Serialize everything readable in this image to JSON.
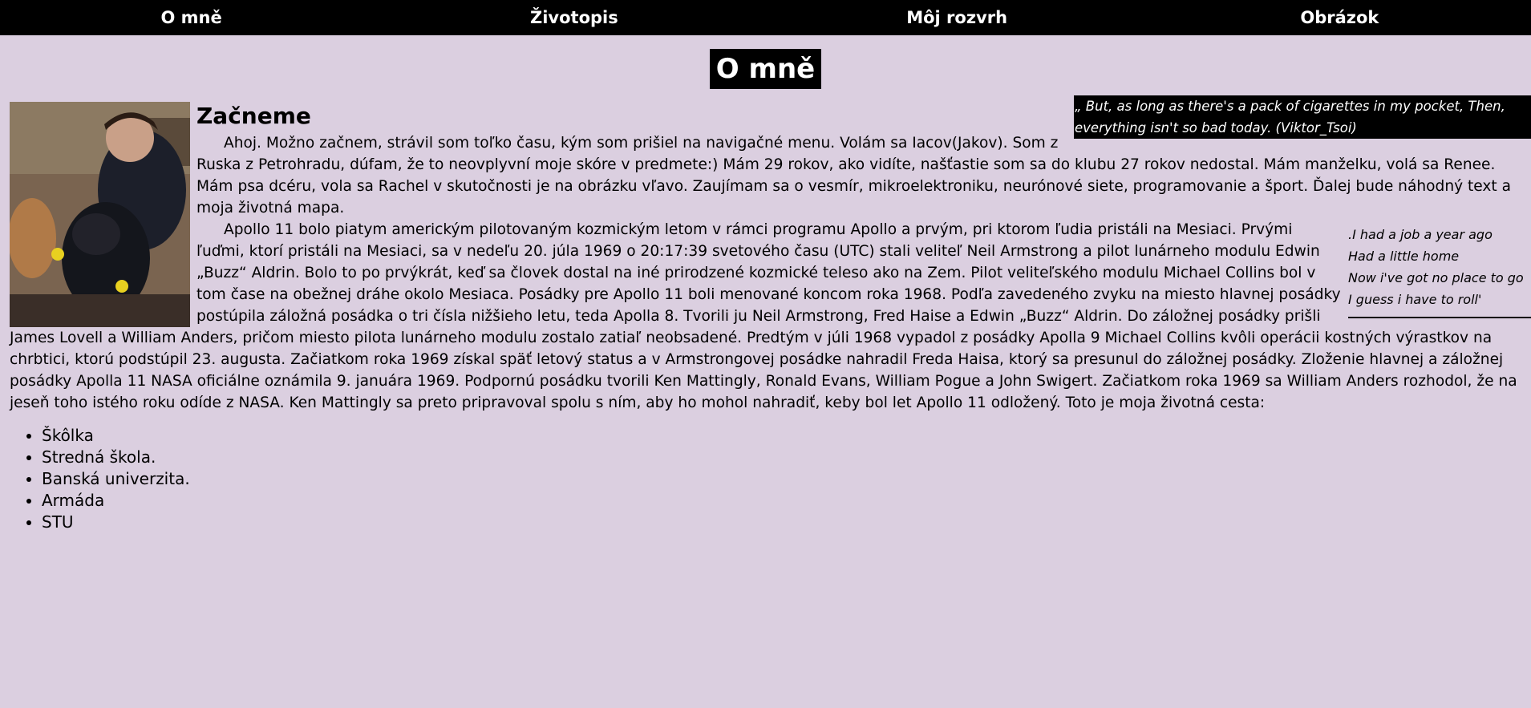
{
  "nav": {
    "items": [
      "O mně",
      "Životopis",
      "Môj rozvrh",
      "Obrázok"
    ]
  },
  "page_title": "O mně",
  "heading": "Začneme",
  "paragraph1": "Ahoj. Možno začnem, strávil som toľko času, kým som prišiel na navigačné menu. Volám sa Iacov(Jakov). Som z Ruska z Petrohradu, dúfam, že to neovplyvní moje skóre v predmete:) Mám 29 rokov, ako vidíte, našťastie som sa do klubu 27 rokov nedostal. Mám manželku, volá sa Renee. Mám psa dcéru, vola sa Rachel v skutočnosti je na obrázku vľavo. Zaujímam sa o vesmír, mikroelektroniku, neurónové siete, programovanie a šport. Ďalej bude náhodný text a moja životná mapa.",
  "paragraph2": "Apollo 11 bolo piatym americkým pilotovaným kozmickým letom v rámci programu Apollo a prvým, pri ktorom ľudia pristáli na Mesiaci. Prvými ľuďmi, ktorí pristáli na Mesiaci, sa v nedeľu 20. júla 1969 o 20:17:39 svetového času (UTC) stali veliteľ Neil Armstrong a pilot lunárneho modulu Edwin „Buzz“ Aldrin. Bolo to po prvýkrát, keď sa človek dostal na iné prirodzené kozmické teleso ako na Zem. Pilot veliteľského modulu Michael Collins bol v tom čase na obežnej dráhe okolo Mesiaca. Posádky pre Apollo 11 boli menované koncom roka 1968. Podľa zavedeného zvyku na miesto hlavnej posádky postúpila záložná posádka o tri čísla nižšieho letu, teda Apolla 8. Tvorili ju Neil Armstrong, Fred Haise a Edwin „Buzz“ Aldrin. Do záložnej posádky prišli James Lovell a William Anders, pričom miesto pilota lunárneho modulu zostalo zatiaľ neobsadené. Predtým v júli 1968 vypadol z posádky Apolla 9 Michael Collins kvôli operácii kostných výrastkov na chrbtici, ktorú podstúpil 23. augusta. Začiatkom roka 1969 získal späť letový status a v Armstrongovej posádke nahradil Freda Haisa, ktorý sa presunul do záložnej posádky. Zloženie hlavnej a záložnej posádky Apolla 11 NASA oficiálne oznámila 9. januára 1969. Podpornú posádku tvorili Ken Mattingly, Ronald Evans, William Pogue a John Swigert. Začiatkom roka 1969 sa William Anders rozhodol, že na jeseň toho istého roku odíde z NASA. Ken Mattingly sa preto pripravoval spolu s ním, aby ho mohol nahradiť, keby bol let Apollo 11 odložený. Toto je moja životná cesta:",
  "quote_top": "„ But, as long as there's a pack of cigarettes in my pocket, Then, everything isn't so bad today. (Viktor_Tsoi)",
  "quote_side": [
    ".I had a job a year ago",
    "Had a little home",
    "Now i've got no place to go",
    "I guess i have to roll'"
  ],
  "life_path": [
    "Škôlka",
    "Stredná škola.",
    "Banská univerzita.",
    "Armáda",
    "STU"
  ],
  "photo_alt": "photo-icon"
}
